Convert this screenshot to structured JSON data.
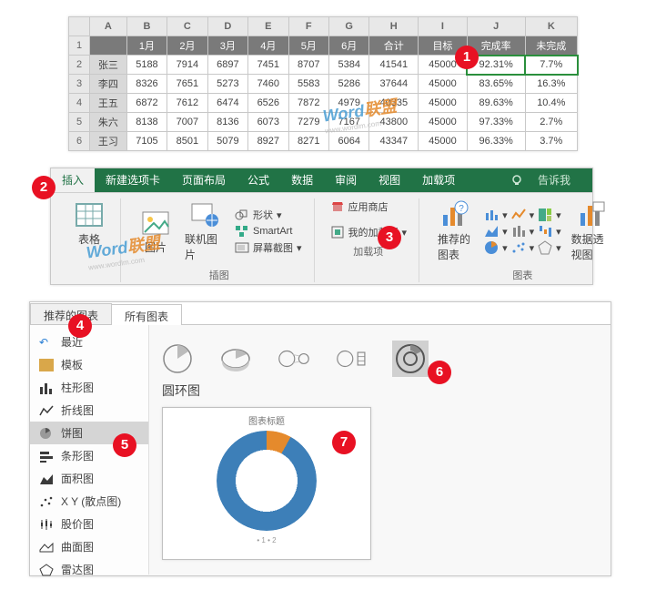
{
  "table": {
    "cols": [
      "",
      "A",
      "B",
      "C",
      "D",
      "E",
      "F",
      "G",
      "H",
      "I",
      "J",
      "K"
    ],
    "headers": [
      "",
      "1月",
      "2月",
      "3月",
      "4月",
      "5月",
      "6月",
      "合计",
      "目标",
      "完成率",
      "未完成"
    ],
    "rows": [
      {
        "n": "2",
        "name": "张三",
        "v": [
          "5188",
          "7914",
          "6897",
          "7451",
          "8707",
          "5384",
          "41541",
          "45000",
          "92.31%",
          "7.7%"
        ]
      },
      {
        "n": "3",
        "name": "李四",
        "v": [
          "8326",
          "7651",
          "5273",
          "7460",
          "5583",
          "5286",
          "37644",
          "45000",
          "83.65%",
          "16.3%"
        ]
      },
      {
        "n": "4",
        "name": "王五",
        "v": [
          "6872",
          "7612",
          "6474",
          "6526",
          "7872",
          "4979",
          "40335",
          "45000",
          "89.63%",
          "10.4%"
        ]
      },
      {
        "n": "5",
        "name": "朱六",
        "v": [
          "8138",
          "7007",
          "8136",
          "6073",
          "7279",
          "7167",
          "43800",
          "45000",
          "97.33%",
          "2.7%"
        ]
      },
      {
        "n": "6",
        "name": "王习",
        "v": [
          "7105",
          "8501",
          "5079",
          "8927",
          "8271",
          "6064",
          "43347",
          "45000",
          "96.33%",
          "3.7%"
        ]
      }
    ]
  },
  "ribbon": {
    "tabs": [
      "插入",
      "新建选项卡",
      "页面布局",
      "公式",
      "数据",
      "审阅",
      "视图",
      "加载项"
    ],
    "tell": "告诉我",
    "groups": {
      "insert_pic": "插图",
      "addin": "加载项",
      "chart": "图表"
    },
    "btns": {
      "table": "表格",
      "pic": "图片",
      "netpic": "联机图片",
      "shape": "形状",
      "smartart": "SmartArt",
      "screenshot": "屏幕截图",
      "store": "应用商店",
      "myadd": "我的加载项",
      "recchart": "推荐的\n图表",
      "pivot": "数据透视图"
    }
  },
  "dialog": {
    "tab1": "推荐的图表",
    "tab2": "所有图表",
    "side": [
      "最近",
      "模板",
      "柱形图",
      "折线图",
      "饼图",
      "条形图",
      "面积图",
      "X Y (散点图)",
      "股价图",
      "曲面图",
      "雷达图"
    ],
    "title": "圆环图",
    "preview_caption": "图表标题",
    "legend": "• 1 • 2"
  },
  "chart_data": {
    "type": "doughnut",
    "title": "图表标题",
    "series": [
      {
        "name": "1",
        "value": 8
      },
      {
        "name": "2",
        "value": 92
      }
    ],
    "colors": [
      "#e58a2c",
      "#3d7fb8"
    ]
  },
  "badges": {
    "b1": "1",
    "b2": "2",
    "b3": "3",
    "b4": "4",
    "b5": "5",
    "b6": "6",
    "b7": "7"
  },
  "wm": {
    "text1": "Word",
    "text2": "联盟",
    "sub": "www.wordlm.com"
  }
}
